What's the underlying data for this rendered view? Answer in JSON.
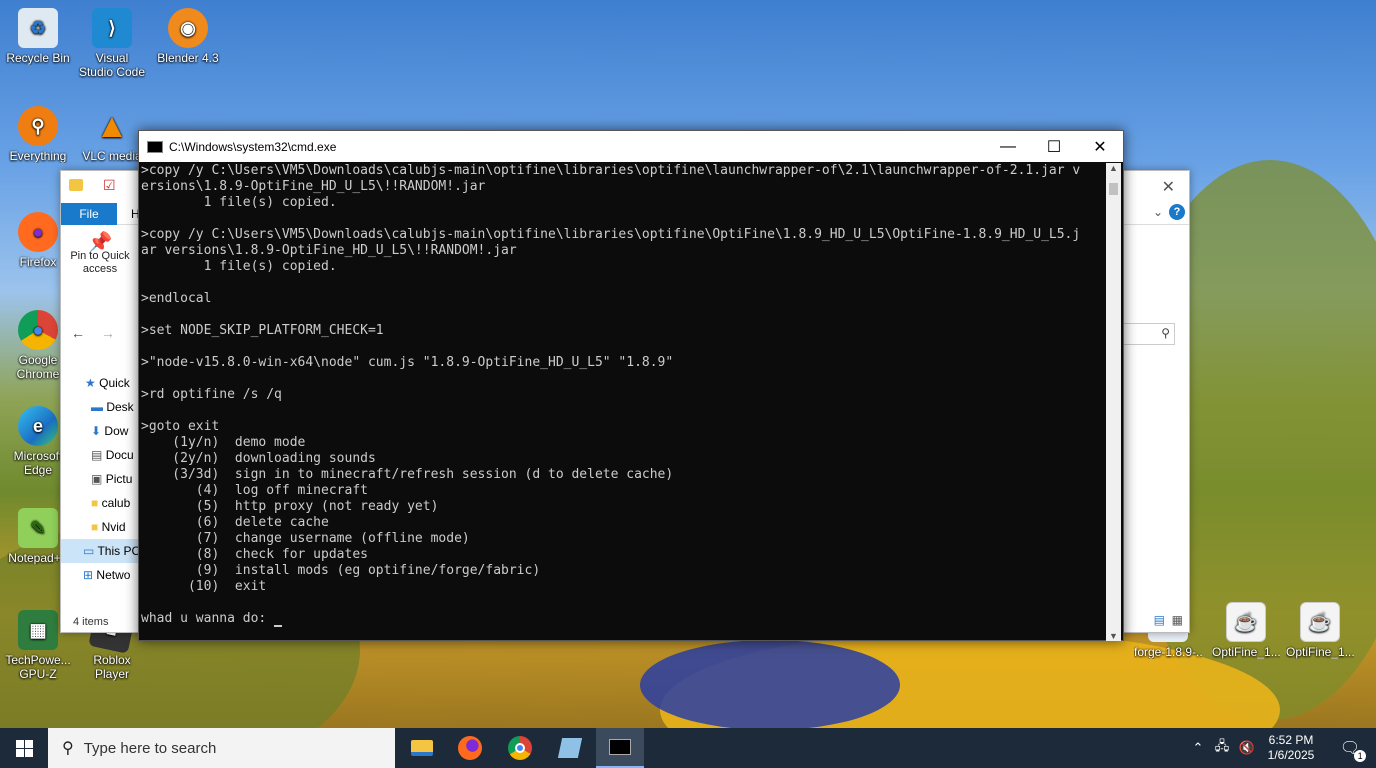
{
  "desktop_icons_left": [
    {
      "label": "Recycle Bin",
      "icon": "recycle-bin-icon"
    },
    {
      "label": "Visual Studio Code",
      "icon": "vscode-icon"
    },
    {
      "label": "Blender 4.3",
      "icon": "blender-icon"
    },
    {
      "label": "Everything",
      "icon": "everything-icon"
    },
    {
      "label": "VLC media",
      "icon": "vlc-icon"
    },
    {
      "label": "Firefox",
      "icon": "firefox-icon"
    },
    {
      "label": "Google Chrome",
      "icon": "chrome-icon"
    },
    {
      "label": "Microsoft Edge",
      "icon": "edge-icon"
    },
    {
      "label": "Notepad++",
      "icon": "notepadpp-icon"
    },
    {
      "label": "TechPowe... GPU-Z",
      "icon": "gpuz-icon"
    },
    {
      "label": "Roblox Player",
      "icon": "roblox-icon"
    }
  ],
  "desktop_icons_right": [
    {
      "label": "forge-1.8.9-...",
      "icon": "jar-file-icon"
    },
    {
      "label": "OptiFine_1....",
      "icon": "java-jar-icon"
    },
    {
      "label": "OptiFine_1....",
      "icon": "java-jar-icon"
    }
  ],
  "explorer": {
    "file_tab": "File",
    "home_tab": "H",
    "pin_label": "Pin to Quick access",
    "nav": [
      "Quick",
      "Desk",
      "Dow",
      "Docu",
      "Pictu",
      "calub",
      "Nvid",
      "This PC",
      "Netwo"
    ],
    "status": "4 items"
  },
  "cmd": {
    "title": "C:\\Windows\\system32\\cmd.exe",
    "output": ">copy /y C:\\Users\\VM5\\Downloads\\calubjs-main\\optifine\\libraries\\optifine\\launchwrapper-of\\2.1\\launchwrapper-of-2.1.jar v\nersions\\1.8.9-OptiFine_HD_U_L5\\!!RANDOM!.jar\n        1 file(s) copied.\n\n>copy /y C:\\Users\\VM5\\Downloads\\calubjs-main\\optifine\\libraries\\optifine\\OptiFine\\1.8.9_HD_U_L5\\OptiFine-1.8.9_HD_U_L5.j\nar versions\\1.8.9-OptiFine_HD_U_L5\\!!RANDOM!.jar\n        1 file(s) copied.\n\n>endlocal\n\n>set NODE_SKIP_PLATFORM_CHECK=1\n\n>\"node-v15.8.0-win-x64\\node\" cum.js \"1.8.9-OptiFine_HD_U_L5\" \"1.8.9\"\n\n>rd optifine /s /q\n\n>goto exit\n    (1y/n)  demo mode\n    (2y/n)  downloading sounds\n    (3/3d)  sign in to minecraft/refresh session (d to delete cache)\n       (4)  log off minecraft\n       (5)  http proxy (not ready yet)\n       (6)  delete cache\n       (7)  change username (offline mode)\n       (8)  check for updates\n       (9)  install mods (eg optifine/forge/fabric)\n      (10)  exit\n\n",
    "prompt": "whad u wanna do: "
  },
  "taskbar": {
    "search_placeholder": "Type here to search",
    "time": "6:52 PM",
    "date": "1/6/2025",
    "notification_count": "1"
  }
}
